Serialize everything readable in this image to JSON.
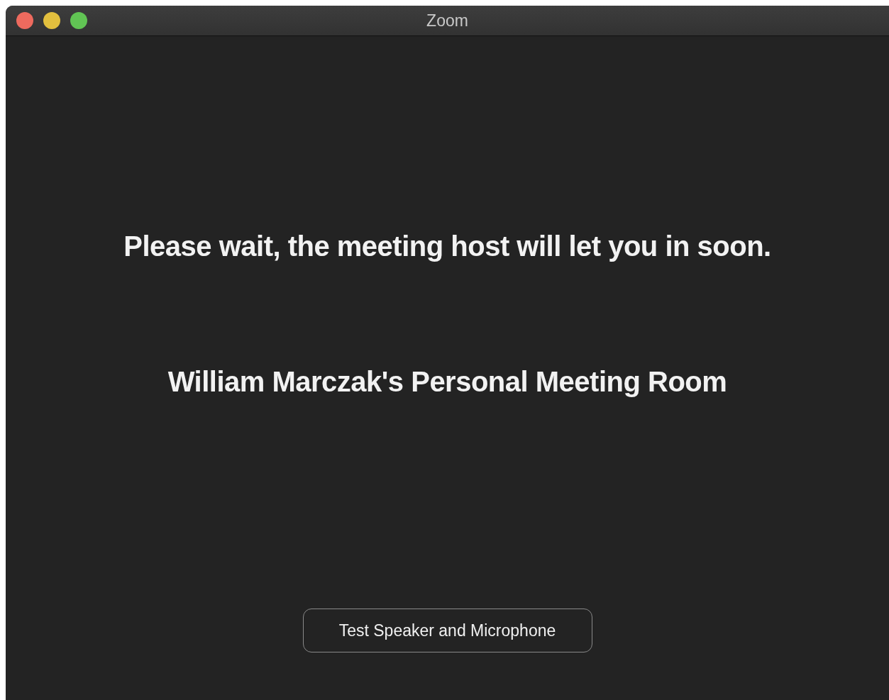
{
  "window": {
    "title": "Zoom"
  },
  "message": "Please wait, the meeting host will let you in soon.",
  "room_name": "William Marczak's Personal Meeting Room",
  "buttons": [
    "Test Speaker and Microphone"
  ]
}
